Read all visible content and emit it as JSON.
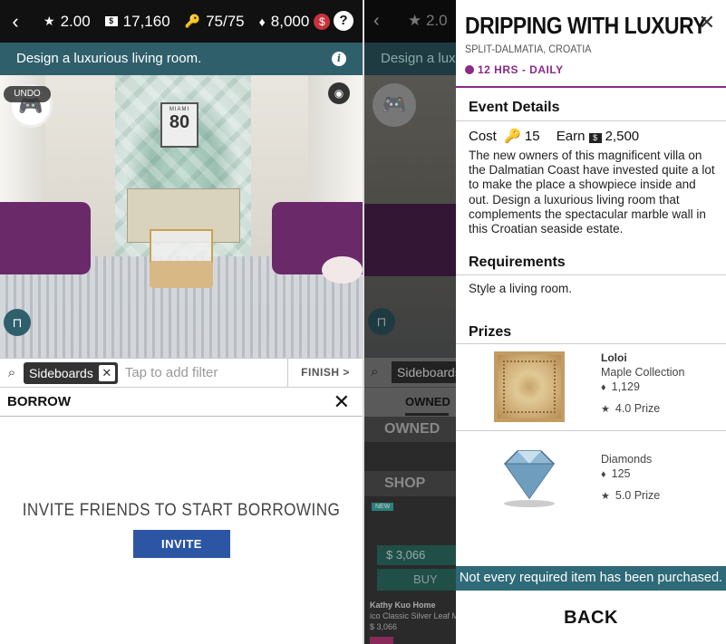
{
  "left": {
    "topbar": {
      "stars": "2.00",
      "cash": "17,160",
      "keys": "75/75",
      "diamonds": "8,000"
    },
    "task": "Design a luxurious living room.",
    "undo_label": "UNDO",
    "frame_text": {
      "top": "MIAMI",
      "number": "80"
    },
    "filter": {
      "chip": "Sideboards",
      "placeholder": "Tap to add filter",
      "finish": "FINISH >"
    },
    "borrow": {
      "title": "BORROW",
      "invite_text": "INVITE FRIENDS TO START BORROWING",
      "invite_button": "INVITE"
    }
  },
  "mid": {
    "stat": "★ 2.0",
    "banner": "Design a luxu",
    "chip": "Sideboards",
    "tab_owned": "OWNED",
    "owned_header": "OWNED",
    "shop_header": "SHOP",
    "new_badge": "NEW",
    "price": "3,066",
    "buy": "BUY",
    "brand": "Kathy Kuo Home",
    "product": "ico Classic Silver Leaf M",
    "small_price": "3,066"
  },
  "right": {
    "title": "DRIPPING WITH LUXURY",
    "location": "SPLIT-DALMATIA, CROATIA",
    "time": "12 HRS - DAILY",
    "event_details": "Event Details",
    "cost_label": "Cost",
    "cost_value": "15",
    "earn_label": "Earn",
    "earn_value": "2,500",
    "description": "The new owners of this magnificent villa on the Dalmatian Coast have invested quite a lot to make the place a showpiece inside and out. Design a luxurious living room that complements the spectacular marble wall in this Croatian seaside estate.",
    "requirements": "Requirements",
    "requirement_text": "Style a living room.",
    "prizes": "Prizes",
    "prize_list": [
      {
        "brand": "Loloi",
        "name": "Maple Collection",
        "value": "1,129",
        "prize": "4.0 Prize"
      },
      {
        "brand": "",
        "name": "Diamonds",
        "value": "125",
        "prize": "5.0 Prize"
      }
    ],
    "warning": "Not every required item has been purchased.",
    "back": "BACK"
  },
  "colors": {
    "accent_purple": "#8a2a8a",
    "teal": "#2f6a78",
    "invite_blue": "#2c56a4",
    "sofa_purple": "#6a2a6a"
  }
}
